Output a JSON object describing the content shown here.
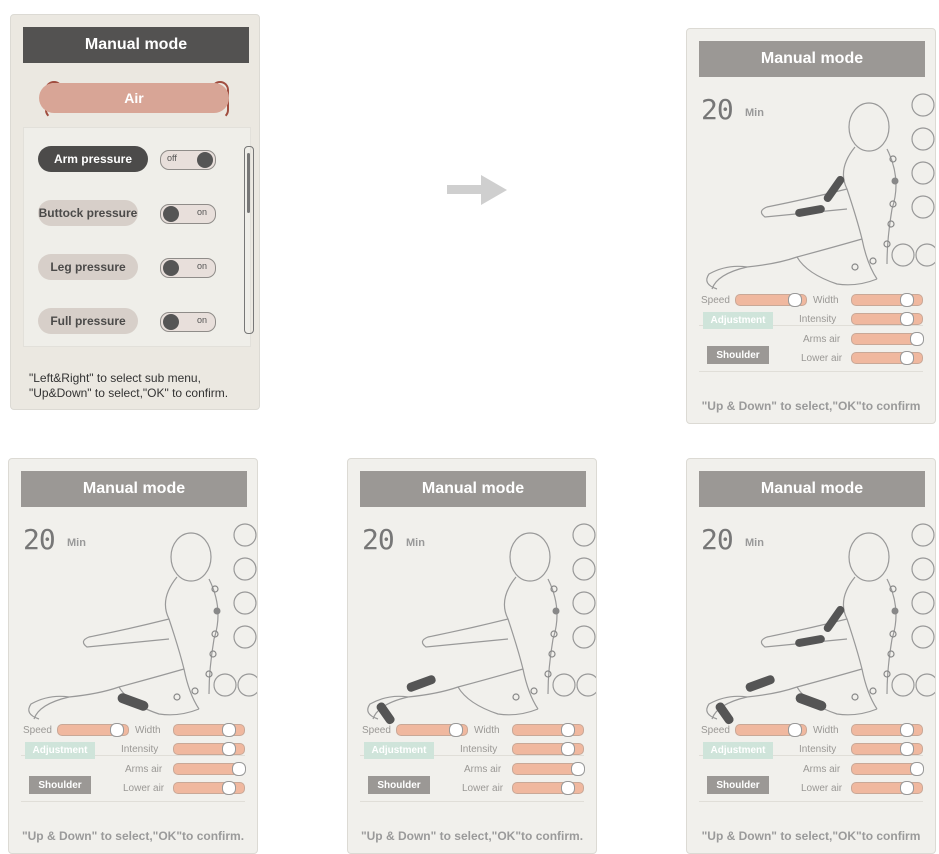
{
  "panel_manual_air": {
    "title": "Manual mode",
    "air_label": "Air",
    "items": [
      {
        "label": "Arm pressure",
        "toggle": "off",
        "active": true
      },
      {
        "label": "Buttock pressure",
        "toggle": "on",
        "active": false
      },
      {
        "label": "Leg pressure",
        "toggle": "on",
        "active": false
      },
      {
        "label": "Full pressure",
        "toggle": "on",
        "active": false
      }
    ],
    "hint_line1": "\"Left&Right\" to select sub menu,",
    "hint_line2": "\"Up&Down\" to select,\"OK\" to confirm."
  },
  "massage_panels": [
    {
      "title": "Manual mode",
      "timer": "20",
      "unit": "Min",
      "speed": "Speed",
      "width": "Width",
      "adjustment": "Adjustment",
      "intensity": "Intensity",
      "arms_air": "Arms air",
      "shoulder": "Shoulder",
      "lower_air": "Lower air",
      "footer": "\"Up & Down\" to select,\"OK\"to confirm"
    },
    {
      "title": "Manual mode",
      "timer": "20",
      "unit": "Min",
      "speed": "Speed",
      "width": "Width",
      "adjustment": "Adjustment",
      "intensity": "Intensity",
      "arms_air": "Arms air",
      "shoulder": "Shoulder",
      "lower_air": "Lower air",
      "footer": "\"Up & Down\" to select,\"OK\"to confirm."
    },
    {
      "title": "Manual mode",
      "timer": "20",
      "unit": "Min",
      "speed": "Speed",
      "width": "Width",
      "adjustment": "Adjustment",
      "intensity": "Intensity",
      "arms_air": "Arms air",
      "shoulder": "Shoulder",
      "lower_air": "Lower air",
      "footer": "\"Up & Down\" to select,\"OK\"to confirm."
    },
    {
      "title": "Manual mode",
      "timer": "20",
      "unit": "Min",
      "speed": "Speed",
      "width": "Width",
      "adjustment": "Adjustment",
      "intensity": "Intensity",
      "arms_air": "Arms air",
      "shoulder": "Shoulder",
      "lower_air": "Lower air",
      "footer": "\"Up & Down\" to select,\"OK\"to confirm"
    }
  ],
  "colors": {
    "title_dark": "#535251",
    "title_gray": "#9b9895",
    "slider": "#f0b89f",
    "adjust": "#cfe4da",
    "air_pill": "#d8a596"
  },
  "icons": {
    "arrow": "right-arrow-icon"
  }
}
